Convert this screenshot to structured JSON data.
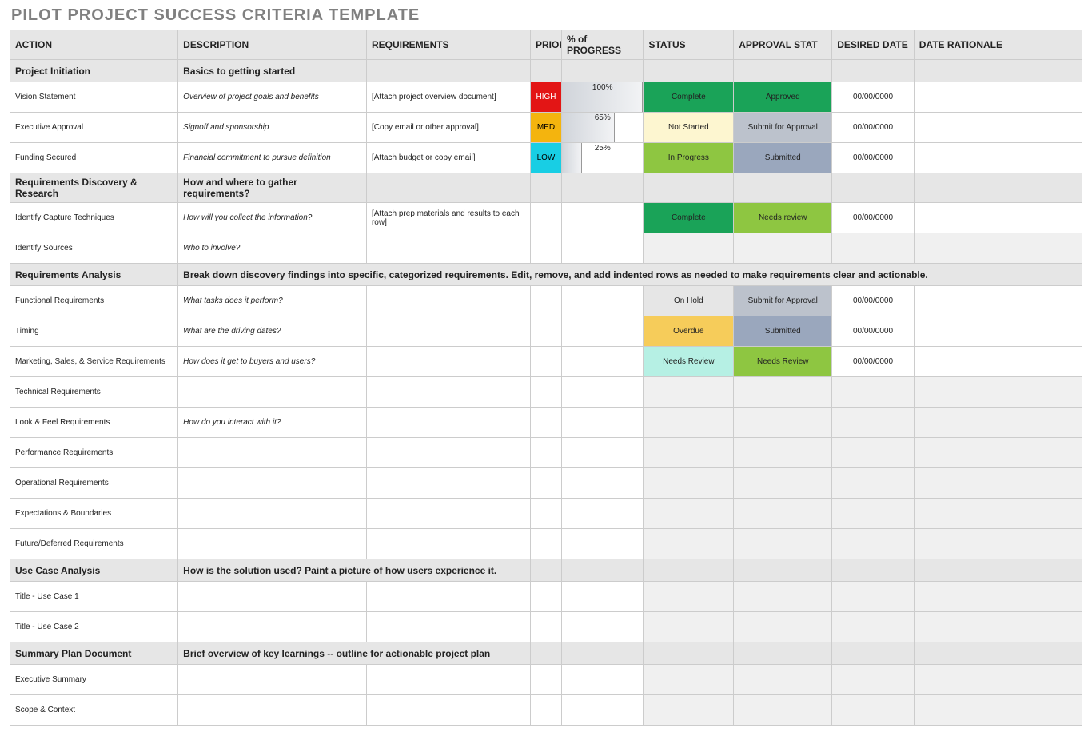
{
  "title": "PILOT PROJECT SUCCESS CRITERIA TEMPLATE",
  "columns": [
    "ACTION",
    "DESCRIPTION",
    "REQUIREMENTS",
    "PRIORITY",
    "% of PROGRESS",
    "STATUS",
    "APPROVAL STAT",
    "DESIRED DATE",
    "DATE RATIONALE"
  ],
  "sections": [
    {
      "action": "Project Initiation",
      "desc": "Basics to getting started",
      "desc_span": 1,
      "rows": [
        {
          "action": "Vision Statement",
          "desc": "Overview of project goals and benefits",
          "req": "[Attach project overview document]",
          "priority": "HIGH",
          "progress": "100%",
          "progress_w": "100%",
          "status": "Complete",
          "status_cls": "status-complete",
          "approval": "Approved",
          "approval_cls": "appr-approved",
          "date": "00/00/0000"
        },
        {
          "action": "Executive Approval",
          "desc": "Signoff and sponsorship",
          "req": "[Copy email or other approval]",
          "priority": "MED",
          "progress": "65%",
          "progress_w": "65%",
          "status": "Not Started",
          "status_cls": "status-notstarted",
          "approval": "Submit for Approval",
          "approval_cls": "appr-submitfor",
          "date": "00/00/0000"
        },
        {
          "action": "Funding Secured",
          "desc": "Financial commitment to pursue definition",
          "req": "[Attach budget or copy email]",
          "priority": "LOW",
          "progress": "25%",
          "progress_w": "25%",
          "status": "In Progress",
          "status_cls": "status-inprogress",
          "approval": "Submitted",
          "approval_cls": "appr-submitted",
          "date": "00/00/0000"
        }
      ]
    },
    {
      "action": "Requirements Discovery & Research",
      "desc": "How and where to gather requirements?",
      "desc_span": 1,
      "rows": [
        {
          "action": "Identify Capture Techniques",
          "desc": "How will you collect the information?",
          "req": "[Attach prep materials and results to each row]",
          "priority": "",
          "progress": "",
          "status": "Complete",
          "status_cls": "status-complete",
          "approval": "Needs review",
          "approval_cls": "appr-needsreview",
          "date": "00/00/0000"
        },
        {
          "action": "Identify Sources",
          "desc": "Who to involve?",
          "req": "",
          "priority": "",
          "progress": "",
          "status": "",
          "status_cls": "",
          "approval": "",
          "approval_cls": "",
          "date": ""
        }
      ]
    },
    {
      "action": "Requirements Analysis",
      "desc": "Break down discovery findings into specific, categorized requirements. Edit, remove, and add indented rows as needed to make requirements clear and actionable.",
      "desc_span": 8,
      "rows": [
        {
          "action": "Functional Requirements",
          "desc": "What tasks does it perform?",
          "req": "",
          "priority": "",
          "progress": "",
          "status": "On Hold",
          "status_cls": "status-onhold",
          "approval": "Submit for Approval",
          "approval_cls": "appr-submitfor",
          "date": "00/00/0000"
        },
        {
          "action": "Timing",
          "desc": "What are the driving dates?",
          "req": "",
          "priority": "",
          "progress": "",
          "status": "Overdue",
          "status_cls": "status-overdue",
          "approval": "Submitted",
          "approval_cls": "appr-submitted",
          "date": "00/00/0000"
        },
        {
          "action": "Marketing, Sales, & Service Requirements",
          "desc": "How does it get to buyers and users?",
          "req": "",
          "priority": "",
          "progress": "",
          "status": "Needs Review",
          "status_cls": "status-needsreview",
          "approval": "Needs Review",
          "approval_cls": "appr-needsreview",
          "date": "00/00/0000"
        },
        {
          "action": "Technical Requirements",
          "desc": "",
          "req": "",
          "priority": "",
          "progress": "",
          "status": "",
          "status_cls": "",
          "approval": "",
          "approval_cls": "",
          "date": ""
        },
        {
          "action": "Look & Feel Requirements",
          "desc": "How do you interact with it?",
          "req": "",
          "priority": "",
          "progress": "",
          "status": "",
          "status_cls": "",
          "approval": "",
          "approval_cls": "",
          "date": ""
        },
        {
          "action": "Performance Requirements",
          "desc": "",
          "req": "",
          "priority": "",
          "progress": "",
          "status": "",
          "status_cls": "",
          "approval": "",
          "approval_cls": "",
          "date": ""
        },
        {
          "action": "Operational Requirements",
          "desc": "",
          "req": "",
          "priority": "",
          "progress": "",
          "status": "",
          "status_cls": "",
          "approval": "",
          "approval_cls": "",
          "date": ""
        },
        {
          "action": "Expectations & Boundaries",
          "desc": "",
          "req": "",
          "priority": "",
          "progress": "",
          "status": "",
          "status_cls": "",
          "approval": "",
          "approval_cls": "",
          "date": ""
        },
        {
          "action": "Future/Deferred Requirements",
          "desc": "",
          "req": "",
          "priority": "",
          "progress": "",
          "status": "",
          "status_cls": "",
          "approval": "",
          "approval_cls": "",
          "date": ""
        }
      ]
    },
    {
      "action": "Use Case Analysis",
      "desc": "How is the solution used? Paint a picture of how users experience it.",
      "desc_span": 2,
      "rows": [
        {
          "action": "Title - Use Case 1",
          "desc": "",
          "req": "",
          "priority": "",
          "progress": "",
          "status": "",
          "status_cls": "",
          "approval": "",
          "approval_cls": "",
          "date": ""
        },
        {
          "action": "Title - Use Case 2",
          "desc": "",
          "req": "",
          "priority": "",
          "progress": "",
          "status": "",
          "status_cls": "",
          "approval": "",
          "approval_cls": "",
          "date": ""
        }
      ]
    },
    {
      "action": "Summary Plan Document",
      "desc": "Brief overview of key learnings -- outline for actionable project plan",
      "desc_span": 2,
      "rows": [
        {
          "action": "Executive Summary",
          "desc": "",
          "req": "",
          "priority": "",
          "progress": "",
          "status": "",
          "status_cls": "",
          "approval": "",
          "approval_cls": "",
          "date": ""
        },
        {
          "action": "Scope & Context",
          "desc": "",
          "req": "",
          "priority": "",
          "progress": "",
          "status": "",
          "status_cls": "",
          "approval": "",
          "approval_cls": "",
          "date": ""
        }
      ]
    }
  ]
}
